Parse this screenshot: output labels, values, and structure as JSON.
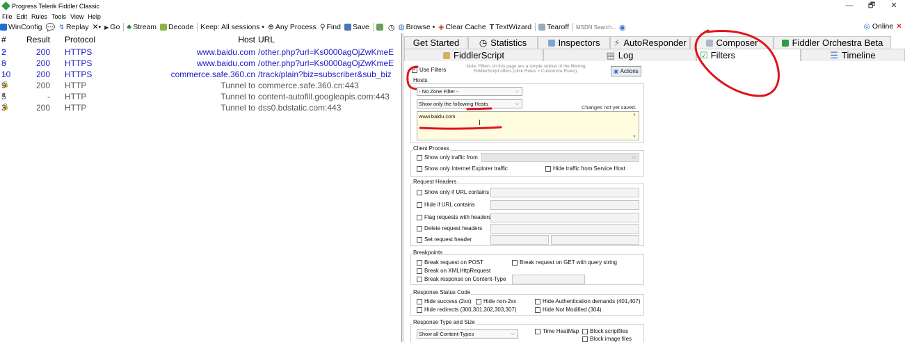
{
  "window": {
    "title": "Progress Telerik Fiddler Classic",
    "minimize": "—",
    "maximize": "🗗",
    "close": "✕"
  },
  "menu": [
    "File",
    "Edit",
    "Rules",
    "Tools",
    "View",
    "Help"
  ],
  "toolbar": {
    "winconfig": "WinConfig",
    "replay": "Replay",
    "remove": "✕•",
    "go": "Go",
    "stream": "Stream",
    "decode": "Decode",
    "keep": "Keep: All sessions •",
    "process": "Any Process",
    "find": "Find",
    "save": "Save",
    "browse": "Browse •",
    "clear_cache": "Clear Cache",
    "textwizard": "TextWizard",
    "tearoff": "Tearoff",
    "msdn_search": "MSDN Search...",
    "online": "Online"
  },
  "sessions": {
    "columns": {
      "num": "#",
      "result": "Result",
      "protocol": "Protocol",
      "host": "Host",
      "url": "URL"
    },
    "rows": [
      {
        "icon": "↔",
        "num": "2",
        "result": "200",
        "protocol": "HTTPS",
        "host": "www.baidu.com",
        "url": "/other.php?url=Ks0000agOjZwKmeE",
        "kind": "https"
      },
      {
        "icon": "↔",
        "num": "8",
        "result": "200",
        "protocol": "HTTPS",
        "host": "www.baidu.com",
        "url": "/other.php?url=Ks0000agOjZwKmeE",
        "kind": "https"
      },
      {
        "icon": "↔",
        "num": "10",
        "result": "200",
        "protocol": "HTTPS",
        "host": "commerce.safe.360.cn",
        "url": "/track/plain?biz=subscriber&sub_biz",
        "kind": "https"
      },
      {
        "icon": "🔒",
        "num": "9",
        "result": "200",
        "protocol": "HTTP",
        "host": "Tunnel to",
        "url": "commerce.safe.360.cn:443",
        "kind": "tunnel"
      },
      {
        "icon": "⬆",
        "num": "5",
        "result": "-",
        "protocol": "HTTP",
        "host": "Tunnel to",
        "url": "content-autofill.googleapis.com:443",
        "kind": "tunnel"
      },
      {
        "icon": "🔒",
        "num": "3",
        "result": "200",
        "protocol": "HTTP",
        "host": "Tunnel to",
        "url": "dss0.bdstatic.com:443",
        "kind": "tunnel"
      }
    ]
  },
  "tabs_row1": [
    "Get Started",
    "Statistics",
    "Inspectors",
    "AutoResponder",
    "Composer",
    "Fiddler Orchestra Beta"
  ],
  "tabs_row2": [
    "FiddlerScript",
    "Log",
    "Filters",
    "Timeline"
  ],
  "filters": {
    "use_filters": "Use Filters",
    "note": "Note: Filters on this page are a simple subset of the filtering FiddlerScript offers (click Rules > Customize Rules).",
    "actions": "Actions",
    "hosts_legend": "Hosts",
    "zone_select": "- No Zone Filter -",
    "host_mode_select": "Show only the following Hosts",
    "changes_not_saved": "Changes not yet saved.",
    "hosts_value": "www.baidu.com",
    "client_process_legend": "Client Process",
    "show_only_traffic_from": "Show only traffic from",
    "show_only_ie": "Show only Internet Explorer traffic",
    "hide_service_host": "Hide traffic from Service Host",
    "request_headers_legend": "Request Headers",
    "show_if_url": "Show only if URL contains",
    "hide_if_url": "Hide if URL contains",
    "flag_headers": "Flag requests with headers",
    "delete_headers": "Delete request headers",
    "set_header": "Set request header",
    "breakpoints_legend": "Breakpoints",
    "break_post": "Break request on POST",
    "break_get_qs": "Break request on GET with query string",
    "break_xhr": "Break on XMLHttpRequest",
    "break_content_type": "Break response on Content-Type",
    "status_legend": "Response Status Code",
    "hide_success": "Hide success (2xx)",
    "hide_non2xx": "Hide non-2xx",
    "hide_auth": "Hide Authentication demands (401,407)",
    "hide_redirects": "Hide redirects (300,301,302,303,307)",
    "hide_not_modified": "Hide Not Modified (304)",
    "type_size_legend": "Response Type and Size",
    "content_types_select": "Show all Content-Types",
    "time_heatmap": "Time HeatMap",
    "block_script": "Block scriptfiles",
    "block_image": "Block image files"
  },
  "colors": {
    "https_text": "#1a1acc",
    "annotation_red": "#e0141c",
    "hosts_area_bg": "#fffce0"
  }
}
